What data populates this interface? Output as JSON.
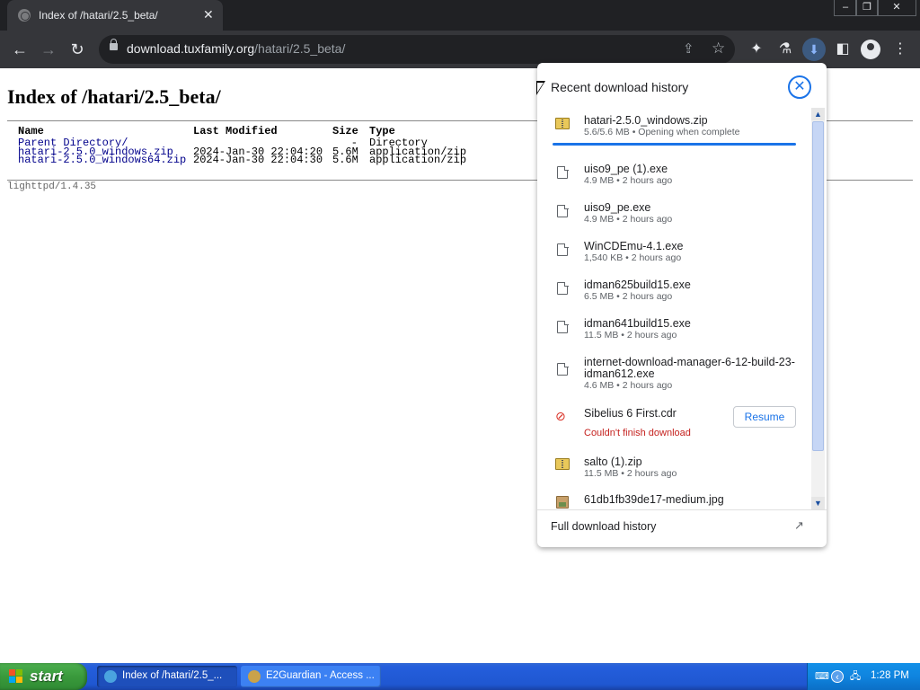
{
  "browser": {
    "tab_title": "Index of /hatari/2.5_beta/",
    "tab_close": "✕",
    "url_host": "download.tuxfamily.org",
    "url_path": "/hatari/2.5_beta/"
  },
  "page": {
    "heading": "Index of /hatari/2.5_beta/",
    "columns": [
      "Name",
      "Last Modified",
      "Size",
      "Type"
    ],
    "rows": [
      {
        "name": "Parent Directory/",
        "modified": "",
        "size": "-",
        "type": "Directory"
      },
      {
        "name": "hatari-2.5.0_windows.zip",
        "modified": "2024-Jan-30 22:04:20",
        "size": "5.6M",
        "type": "application/zip"
      },
      {
        "name": "hatari-2.5.0_windows64.zip",
        "modified": "2024-Jan-30 22:04:30",
        "size": "5.6M",
        "type": "application/zip"
      }
    ],
    "server": "lighttpd/1.4.35"
  },
  "downloads": {
    "title": "Recent download history",
    "items": [
      {
        "name": "hatari-2.5.0_windows.zip",
        "meta": "5.6/5.6 MB • Opening when complete",
        "icon": "zip-icon",
        "progress": 1.0
      },
      {
        "name": "uiso9_pe (1).exe",
        "meta": "4.9 MB • 2 hours ago",
        "icon": "file-icon"
      },
      {
        "name": "uiso9_pe.exe",
        "meta": "4.9 MB • 2 hours ago",
        "icon": "file-icon"
      },
      {
        "name": "WinCDEmu-4.1.exe",
        "meta": "1,540 KB • 2 hours ago",
        "icon": "file-icon"
      },
      {
        "name": "idman625build15.exe",
        "meta": "6.5 MB • 2 hours ago",
        "icon": "file-icon"
      },
      {
        "name": "idman641build15.exe",
        "meta": "11.5 MB • 2 hours ago",
        "icon": "file-icon"
      },
      {
        "name_line1": "internet-download-manager-6-12-build-23-",
        "name_line2": "idman612.exe",
        "meta": "4.6 MB • 2 hours ago",
        "icon": "file-icon"
      },
      {
        "name": "Sibelius 6 First.cdr",
        "error": "Couldn't finish download",
        "action": "Resume",
        "icon": "error-icon"
      },
      {
        "name": "salto (1).zip",
        "meta": "11.5 MB • 2 hours ago",
        "icon": "zip-icon"
      },
      {
        "name": "61db1fb39de17-medium.jpg",
        "icon": "image-icon"
      }
    ],
    "footer": "Full download history"
  },
  "taskbar": {
    "start": "start",
    "items": [
      "Index of /hatari/2.5_...",
      "E2Guardian - Access ..."
    ],
    "clock": "1:28 PM"
  },
  "colors": {
    "accent": "#1a73e8",
    "error": "#c5221f",
    "chrome_dark": "#35363a"
  }
}
